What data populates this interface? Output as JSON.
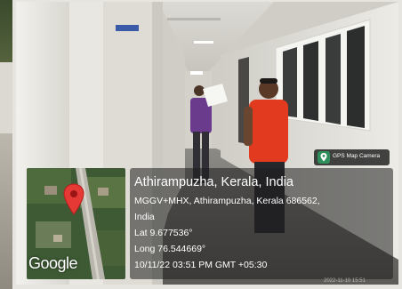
{
  "location": {
    "title": "Athirampuzha, Kerala, India",
    "address_line1": "MGGV+MHX, Athirampuzha, Kerala 686562,",
    "address_line2": "India",
    "latitude": "Lat 9.677536°",
    "longitude": "Long 76.544669°",
    "timestamp": "10/11/22 03:51 PM GMT +05:30"
  },
  "map": {
    "provider_logo": "Google",
    "pin_color": "#e53935"
  },
  "app_badge": {
    "label": "GPS Map Camera",
    "icon": "map-pin-icon"
  },
  "watermark": "2022-11-10 15:51",
  "colors": {
    "overlay": "rgba(30,30,30,0.55)",
    "shirt_red": "#e23a1f",
    "shirt_purple": "#6a3a8c"
  }
}
